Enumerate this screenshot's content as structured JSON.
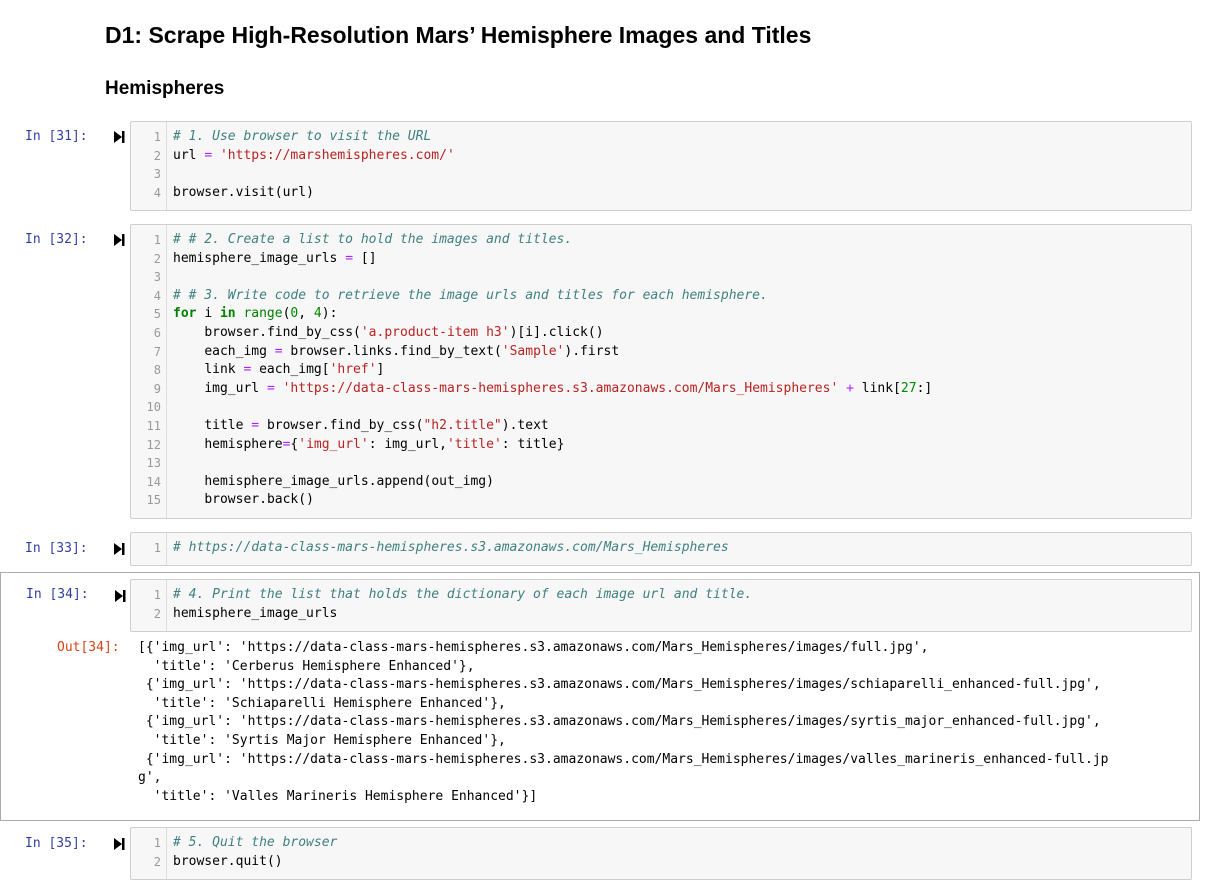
{
  "heading": "D1: Scrape High-Resolution Mars’ Hemisphere Images and Titles",
  "subheading": "Hemispheres",
  "cells": [
    {
      "prompt": "In [31]:",
      "lines": [
        "# 1. Use browser to visit the URL",
        "url = 'https://marshemispheres.com/'",
        "",
        "browser.visit(url)"
      ]
    },
    {
      "prompt": "In [32]:",
      "lines": [
        "# # 2. Create a list to hold the images and titles.",
        "hemisphere_image_urls = []",
        "",
        "# # 3. Write code to retrieve the image urls and titles for each hemisphere.",
        "for i in range(0, 4):",
        "    browser.find_by_css('a.product-item h3')[i].click()",
        "    each_img = browser.links.find_by_text('Sample').first",
        "    link = each_img['href']",
        "    img_url = 'https://data-class-mars-hemispheres.s3.amazonaws.com/Mars_Hemispheres' + link[27:]",
        "",
        "    title = browser.find_by_css(\"h2.title\").text",
        "    hemisphere={'img_url': img_url,'title': title}",
        "",
        "    hemisphere_image_urls.append(out_img)",
        "    browser.back()"
      ]
    },
    {
      "prompt": "In [33]:",
      "lines": [
        "# https://data-class-mars-hemispheres.s3.amazonaws.com/Mars_Hemispheres"
      ]
    },
    {
      "prompt": "In [34]:",
      "lines": [
        "# 4. Print the list that holds the dictionary of each image url and title.",
        "hemisphere_image_urls"
      ],
      "out_prompt": "Out[34]:",
      "output": [
        "[{'img_url': 'https://data-class-mars-hemispheres.s3.amazonaws.com/Mars_Hemispheres/images/full.jpg',",
        "  'title': 'Cerberus Hemisphere Enhanced'},",
        " {'img_url': 'https://data-class-mars-hemispheres.s3.amazonaws.com/Mars_Hemispheres/images/schiaparelli_enhanced-full.jpg',",
        "  'title': 'Schiaparelli Hemisphere Enhanced'},",
        " {'img_url': 'https://data-class-mars-hemispheres.s3.amazonaws.com/Mars_Hemispheres/images/syrtis_major_enhanced-full.jpg',",
        "  'title': 'Syrtis Major Hemisphere Enhanced'},",
        " {'img_url': 'https://data-class-mars-hemispheres.s3.amazonaws.com/Mars_Hemispheres/images/valles_marineris_enhanced-full.jp",
        "g',",
        "  'title': 'Valles Marineris Hemisphere Enhanced'}]"
      ]
    },
    {
      "prompt": "In [35]:",
      "lines": [
        "# 5. Quit the browser",
        "browser.quit()"
      ]
    }
  ],
  "colors": {
    "comment": "#408080",
    "string": "#ba2121",
    "keyword": "#008000",
    "builtin": "#008000",
    "operator": "#aa22ff",
    "number": "#008800",
    "in_prompt": "#303f9f",
    "out_prompt": "#d84315"
  },
  "icons": {
    "run": "run-cell-icon"
  }
}
